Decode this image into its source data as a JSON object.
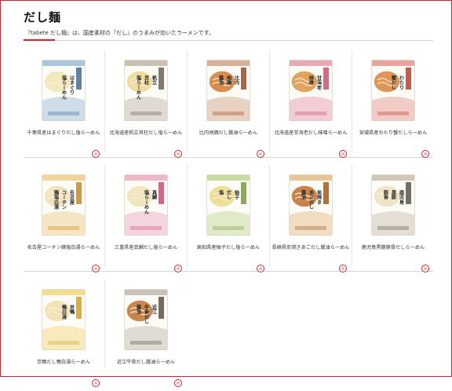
{
  "page": {
    "title": "だし麺",
    "subtitle": "『tabete だし麺』は、国産素材の『だし』のうまみが効いたラーメンです。"
  },
  "products": [
    {
      "name": "千葉県産はまぐりだし塩らーめん",
      "pack_text": [
        "はまぐり",
        "塩らーめん"
      ],
      "accent": "#a8c7dd",
      "soup": "#f3e8b9",
      "band": "#3c6f9a"
    },
    {
      "name": "北海道産帆立貝柱だし塩らーめん",
      "pack_text": [
        "帆立",
        "貝柱",
        "塩らーめん"
      ],
      "accent": "#c9c1b5",
      "soup": "#efdca0",
      "band": "#6b6258"
    },
    {
      "name": "比内地鶏だし醤油らーめん",
      "pack_text": [
        "比内",
        "地鶏",
        "醤油"
      ],
      "accent": "#d9b097",
      "soup": "#d98c4e",
      "band": "#9a4b2c"
    },
    {
      "name": "北海道産甘海老だし味噌らーめん",
      "pack_text": [
        "甘海老",
        "味噌"
      ],
      "accent": "#e9a8b6",
      "soup": "#e2a35c",
      "band": "#c4536e"
    },
    {
      "name": "宮城県産わたり蟹だしらーめん",
      "pack_text": [
        "わたり",
        "蟹だし"
      ],
      "accent": "#e9a4a0",
      "soup": "#e09456",
      "band": "#c0392b"
    },
    {
      "name": "名古屋コーチン鶏塩白湯らーめん",
      "pack_text": [
        "名古屋",
        "コーチン",
        "鶏塩白湯"
      ],
      "accent": "#f1d497",
      "soup": "#f1e3bf",
      "band": "#c98a1e"
    },
    {
      "name": "三重県産真鯛だし塩らーめん",
      "pack_text": [
        "真鯛",
        "塩らーめん"
      ],
      "accent": "#efb7c9",
      "soup": "#f1e5bd",
      "band": "#c24f7a"
    },
    {
      "name": "高知県産柚子だし塩らーめん",
      "pack_text": [
        "柚子",
        "だし",
        "塩"
      ],
      "accent": "#c8dca2",
      "soup": "#efdd9a",
      "band": "#7b9a38"
    },
    {
      "name": "長崎県炭焼きあごだし醤油らーめん",
      "pack_text": [
        "炭焼き",
        "あごだし",
        "醤油"
      ],
      "accent": "#e8c597",
      "soup": "#c9834a",
      "band": "#9c5a1f"
    },
    {
      "name": "鹿児島黒豚豚骨だしらーめん",
      "pack_text": [
        "鹿児島",
        "黒豚",
        "豚骨"
      ],
      "accent": "#cfc7ba",
      "soup": "#f0e4c7",
      "band": "#5e5548"
    },
    {
      "name": "京鴨だし鴨白湯らーめん",
      "pack_text": [
        "京鴨",
        "鴨白湯"
      ],
      "accent": "#f4dc8e",
      "soup": "#f3e3b6",
      "band": "#d4a21c"
    },
    {
      "name": "近江牛骨だし醤油らーめん",
      "pack_text": [
        "近江",
        "牛骨だし",
        "醤油"
      ],
      "accent": "#c9c2b8",
      "soup": "#c9874e",
      "band": "#5b5046"
    }
  ],
  "icons": {
    "card_action": "circle-arrow-icon"
  },
  "colors": {
    "brand_red": "#c9242b",
    "divider": "#d4d4d4"
  }
}
